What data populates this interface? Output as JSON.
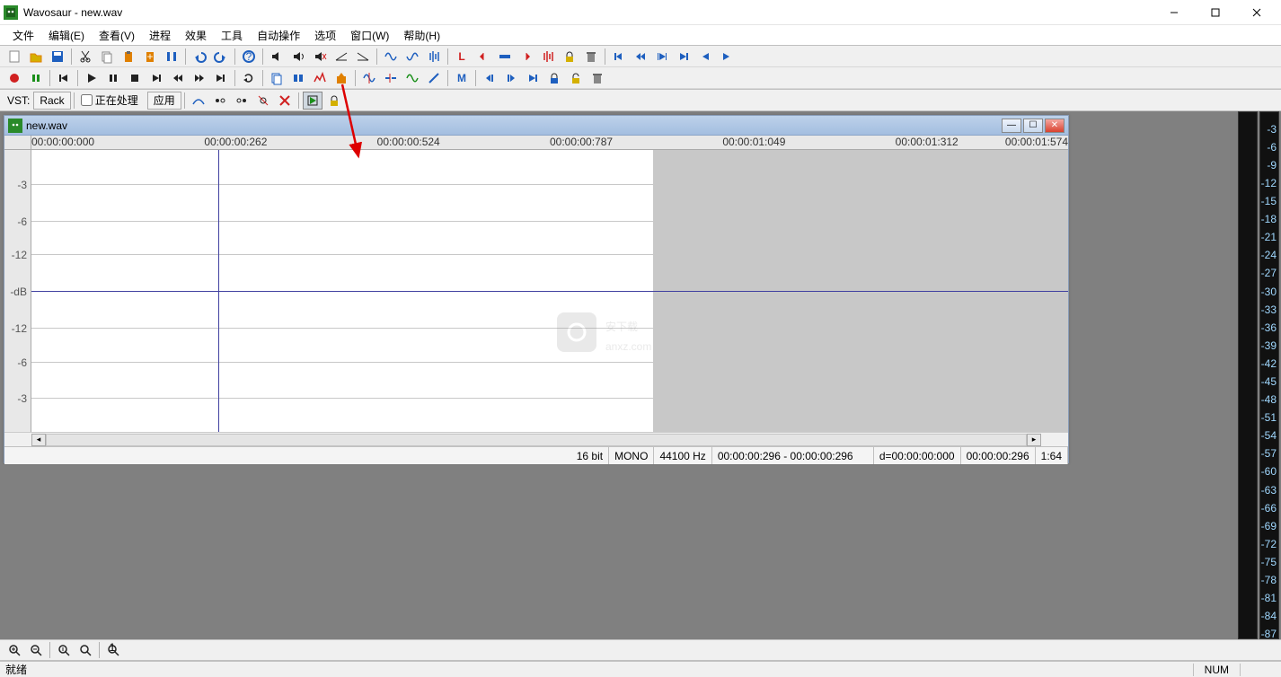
{
  "app": {
    "title": "Wavosaur - new.wav"
  },
  "menu": {
    "items": [
      "文件",
      "编辑(E)",
      "查看(V)",
      "进程",
      "效果",
      "工具",
      "自动操作",
      "选项",
      "窗口(W)",
      "帮助(H)"
    ]
  },
  "vst": {
    "label": "VST:",
    "rack": "Rack",
    "processing_checkbox": "正在处理",
    "apply": "应用"
  },
  "document": {
    "title": "new.wav",
    "timeline": [
      "00:00:00:000",
      "00:00:00:262",
      "00:00:00:524",
      "00:00:00:787",
      "00:00:01:049",
      "00:00:01:312",
      "00:00:01:574"
    ],
    "db_scale": [
      "-3",
      "-6",
      "-12",
      "-dB",
      "-12",
      "-6",
      "-3"
    ],
    "status": {
      "bit": "16 bit",
      "ch": "MONO",
      "sr": "44100 Hz",
      "sel": "00:00:00:296 - 00:00:00:296",
      "dur": "d=00:00:00:000",
      "pos": "00:00:00:296",
      "ratio": "1:64"
    }
  },
  "meter": {
    "labels": [
      "-3",
      "-6",
      "-9",
      "-12",
      "-15",
      "-18",
      "-21",
      "-24",
      "-27",
      "-30",
      "-33",
      "-36",
      "-39",
      "-42",
      "-45",
      "-48",
      "-51",
      "-54",
      "-57",
      "-60",
      "-63",
      "-66",
      "-69",
      "-72",
      "-75",
      "-78",
      "-81",
      "-84",
      "-87"
    ]
  },
  "status": {
    "ready": "就绪",
    "numlock": "NUM"
  },
  "icons": {
    "toolbar1": [
      "new",
      "open",
      "save",
      "cut",
      "copy",
      "paste",
      "paste-special",
      "crop",
      "undo",
      "redo",
      "help",
      "volume",
      "volume-shape",
      "mute",
      "fade-in",
      "fade-out",
      "wave-invert",
      "wave-reverse",
      "normalize",
      "loop-L",
      "marker-del",
      "level",
      "marker-add",
      "process",
      "lock",
      "trash",
      "skip-start",
      "rewind",
      "play-sel",
      "to-marker",
      "play-left",
      "play-right"
    ],
    "toolbar2": [
      "record",
      "rec-pause",
      "to-start",
      "play",
      "pause",
      "stop",
      "to-end",
      "prev",
      "next",
      "end",
      "loop",
      "copy-chan",
      "mix",
      "wave-graph",
      "export",
      "wave-tune",
      "wave-split",
      "wave-env",
      "pitch",
      "marker",
      "m-prev",
      "m-next",
      "m-right",
      "m-lock",
      "unlock",
      "m-trash"
    ],
    "toolbar3": [
      "curve",
      "path-prev",
      "path-next",
      "path-del",
      "path-clear",
      "eval",
      "lock"
    ],
    "zoom": [
      "zoom-in-h",
      "zoom-out-h",
      "zoom-v-in",
      "zoom-v-out",
      "zoom-reset"
    ]
  },
  "watermark": {
    "text": "安下载",
    "domain": "anxz.com"
  }
}
